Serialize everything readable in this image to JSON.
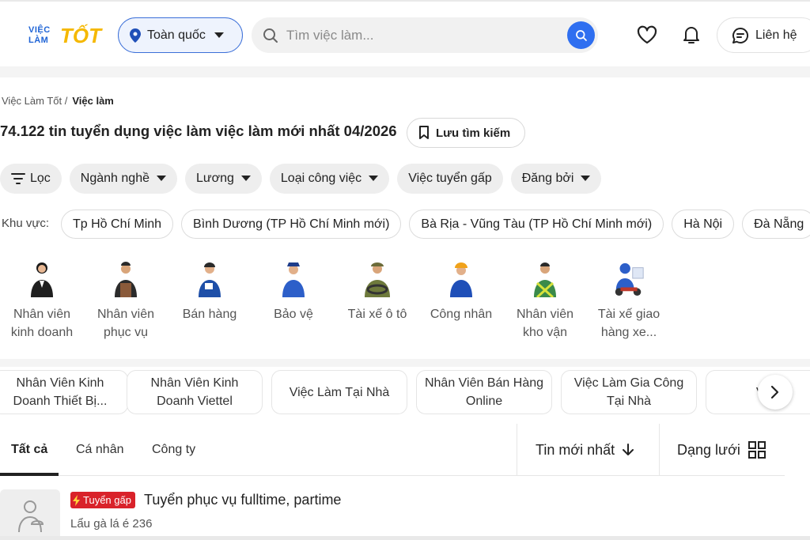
{
  "header": {
    "logo": {
      "line1": "VIỆC",
      "line2": "LÀM",
      "line3": "TỐT"
    },
    "location_label": "Toàn quốc",
    "search_placeholder": "Tìm việc làm...",
    "contact_label": "Liên hệ",
    "colors": {
      "brand_blue": "#1f64d6",
      "brand_yellow": "#f5b800",
      "accent": "#2f6ff0"
    }
  },
  "breadcrumb": {
    "home": "Việc Làm Tốt /",
    "current": "Việc làm"
  },
  "page_title": "74.122 tin tuyển dụng việc làm việc làm mới nhất 04/2026",
  "save_search_label": "Lưu tìm kiếm",
  "filters": [
    {
      "label": "Lọc",
      "icon": "filter-icon",
      "dropdown": false
    },
    {
      "label": "Ngành nghề",
      "dropdown": true
    },
    {
      "label": "Lương",
      "dropdown": true
    },
    {
      "label": "Loại công việc",
      "dropdown": true
    },
    {
      "label": "Việc tuyển gấp",
      "dropdown": false
    },
    {
      "label": "Đăng bởi",
      "dropdown": true
    }
  ],
  "area": {
    "label": "Khu vực:",
    "items": [
      "Tp Hồ Chí Minh",
      "Bình Dương (TP Hồ Chí Minh mới)",
      "Bà Rịa - Vũng Tàu (TP Hồ Chí Minh mới)",
      "Hà Nội",
      "Đà Nẵng"
    ]
  },
  "categories": [
    {
      "label": "Nhân viên kinh doanh",
      "icon": "businesswoman-icon"
    },
    {
      "label": "Nhân viên phục vụ",
      "icon": "waiter-icon"
    },
    {
      "label": "Bán hàng",
      "icon": "salesperson-icon"
    },
    {
      "label": "Bảo vệ",
      "icon": "security-guard-icon"
    },
    {
      "label": "Tài xế ô tô",
      "icon": "driver-icon"
    },
    {
      "label": "Công nhân",
      "icon": "worker-icon"
    },
    {
      "label": "Nhân viên kho vận",
      "icon": "warehouse-worker-icon"
    },
    {
      "label": "Tài xế giao hàng xe...",
      "icon": "delivery-rider-icon"
    }
  ],
  "keywords": [
    "Nhân Viên Kinh Doanh Thiết Bị...",
    "Nhân Viên Kinh Doanh Viettel",
    "Việc Làm Tại Nhà",
    "Nhân Viên Bán Hàng Online",
    "Việc Làm Gia Công Tại Nhà",
    "Việc L"
  ],
  "tabs": {
    "all": "Tất cả",
    "personal": "Cá nhân",
    "company": "Công ty"
  },
  "sort_label": "Tin mới nhất",
  "view_label": "Dạng lưới",
  "job": {
    "badge": "Tuyển gấp",
    "title": "Tuyển phục vụ fulltime, partime",
    "employer": "Lẩu gà lá é 236"
  }
}
